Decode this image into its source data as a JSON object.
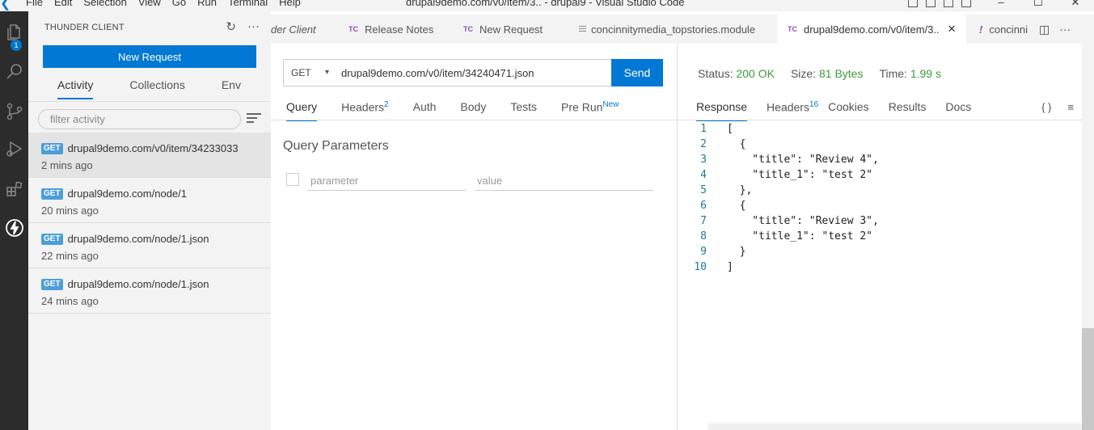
{
  "titlebar": {
    "menu": [
      "File",
      "Edit",
      "Selection",
      "View",
      "Go",
      "Run",
      "Terminal",
      "Help"
    ],
    "window_title": "drupal9demo.com/v0/item/3.. - drupal9 - Visual Studio Code",
    "controls": [
      "–",
      "☐",
      "✕"
    ]
  },
  "activitybar": {
    "explorer_badge": "1"
  },
  "sidebar": {
    "header": "THUNDER CLIENT",
    "new_request": "New Request",
    "tabs": [
      "Activity",
      "Collections",
      "Env"
    ],
    "filter_placeholder": "filter activity",
    "activity": [
      {
        "method": "GET",
        "url": "drupal9demo.com/v0/item/34233033",
        "time": "2 mins ago"
      },
      {
        "method": "GET",
        "url": "drupal9demo.com/node/1",
        "time": "20 mins ago"
      },
      {
        "method": "GET",
        "url": "drupal9demo.com/node/1.json",
        "time": "22 mins ago"
      },
      {
        "method": "GET",
        "url": "drupal9demo.com/node/1.json",
        "time": "24 mins ago"
      }
    ]
  },
  "tabs": [
    {
      "label": "der Client"
    },
    {
      "prefix": "TC",
      "label": "Release Notes"
    },
    {
      "prefix": "TC",
      "label": "New Request"
    },
    {
      "prefix": "",
      "label": "concinnitymedia_topstories.module"
    },
    {
      "prefix": "TC",
      "label": "drupal9demo.com/v0/item/3..",
      "close": "✕"
    },
    {
      "prefix": "!",
      "label": "concinni"
    }
  ],
  "request": {
    "method": "GET",
    "url": "drupal9demo.com/v0/item/34240471.json",
    "send": "Send",
    "tabs": {
      "query": "Query",
      "headers": "Headers",
      "headers_count": "2",
      "auth": "Auth",
      "body": "Body",
      "tests": "Tests",
      "prerun": "Pre Run",
      "prerun_badge": "New"
    },
    "query_title": "Query Parameters",
    "param_placeholder": "parameter",
    "value_placeholder": "value"
  },
  "response": {
    "status_label": "Status:",
    "status_value": "200 OK",
    "size_label": "Size:",
    "size_value": "81 Bytes",
    "time_label": "Time:",
    "time_value": "1.99 s",
    "tabs": {
      "response": "Response",
      "headers": "Headers",
      "headers_count": "16",
      "cookies": "Cookies",
      "results": "Results",
      "docs": "Docs"
    },
    "tools": [
      "{ }",
      "≡"
    ],
    "lines": [
      {
        "n": "1",
        "text": "["
      },
      {
        "n": "2",
        "text": "  {"
      },
      {
        "n": "3",
        "text": "    \"title\": \"Review 4\","
      },
      {
        "n": "4",
        "text": "    \"title_1\": \"test 2\""
      },
      {
        "n": "5",
        "text": "  },"
      },
      {
        "n": "6",
        "text": "  {"
      },
      {
        "n": "7",
        "text": "    \"title\": \"Review 3\","
      },
      {
        "n": "8",
        "text": "    \"title_1\": \"test 2\""
      },
      {
        "n": "9",
        "text": "  }"
      },
      {
        "n": "10",
        "text": "]"
      }
    ]
  }
}
